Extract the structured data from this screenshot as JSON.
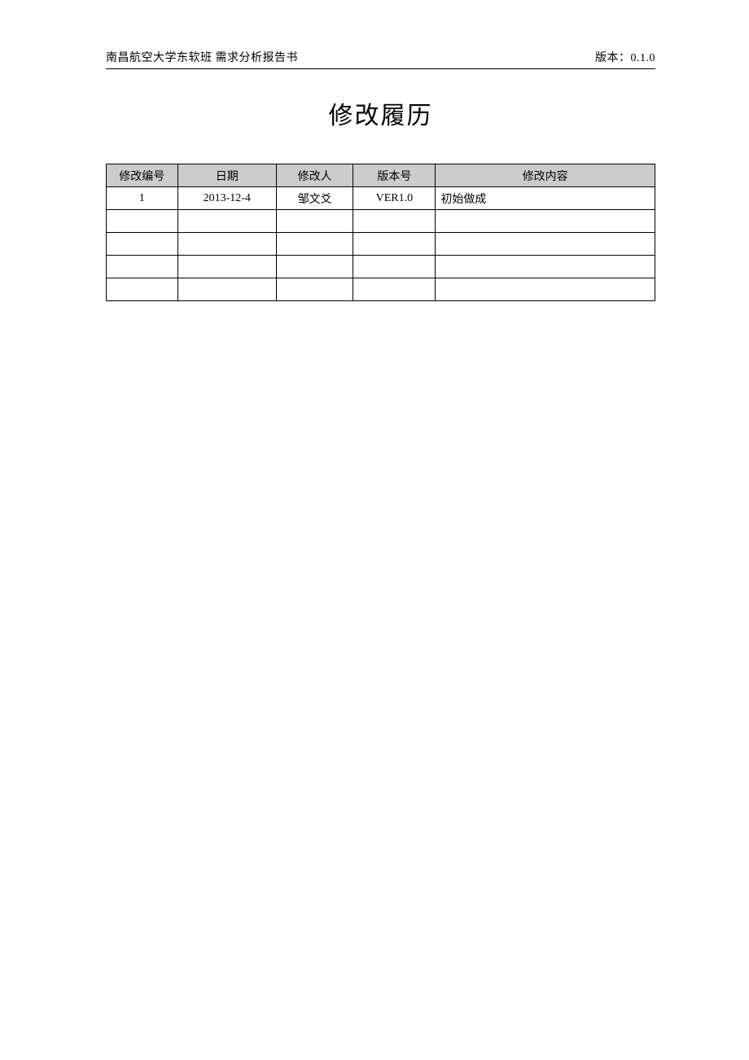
{
  "header": {
    "left": "南昌航空大学东软班  需求分析报告书",
    "right": "版本：0.1.0"
  },
  "title": "修改履历",
  "table": {
    "headers": [
      "修改编号",
      "日期",
      "修改人",
      "版本号",
      "修改内容"
    ],
    "rows": [
      {
        "id": "1",
        "date": "2013-12-4",
        "author": "邹文爻",
        "version": "VER1.0",
        "content": "初始做成"
      },
      {
        "id": "",
        "date": "",
        "author": "",
        "version": "",
        "content": ""
      },
      {
        "id": "",
        "date": "",
        "author": "",
        "version": "",
        "content": ""
      },
      {
        "id": "",
        "date": "",
        "author": "",
        "version": "",
        "content": ""
      },
      {
        "id": "",
        "date": "",
        "author": "",
        "version": "",
        "content": ""
      }
    ]
  }
}
